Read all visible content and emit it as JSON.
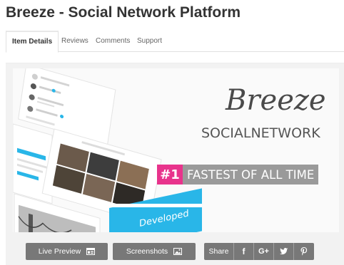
{
  "page": {
    "title": "Breeze - Social Network Platform"
  },
  "tabs": [
    {
      "label": "Item Details",
      "active": true
    },
    {
      "label": "Reviews",
      "active": false
    },
    {
      "label": "Comments",
      "active": false
    },
    {
      "label": "Support",
      "active": false
    }
  ],
  "preview": {
    "brand_name": "Breeze",
    "brand_subtitle": "SOCIALNETWORK",
    "tag_number": "#1",
    "tag_text": "FASTEST OF ALL TIME",
    "mock_card_text": "Developed",
    "accent_pink": "#e8338c",
    "accent_blue": "#29b6e8"
  },
  "actions": {
    "live_preview": "Live Preview",
    "live_preview_icon": "window-icon",
    "screenshots": "Screenshots",
    "screenshots_icon": "image-icon",
    "share_label": "Share",
    "social": [
      {
        "name": "facebook-icon",
        "glyph": "f"
      },
      {
        "name": "google-plus-icon",
        "glyph": "G+"
      },
      {
        "name": "twitter-icon",
        "glyph": ""
      },
      {
        "name": "pinterest-icon",
        "glyph": ""
      }
    ]
  }
}
